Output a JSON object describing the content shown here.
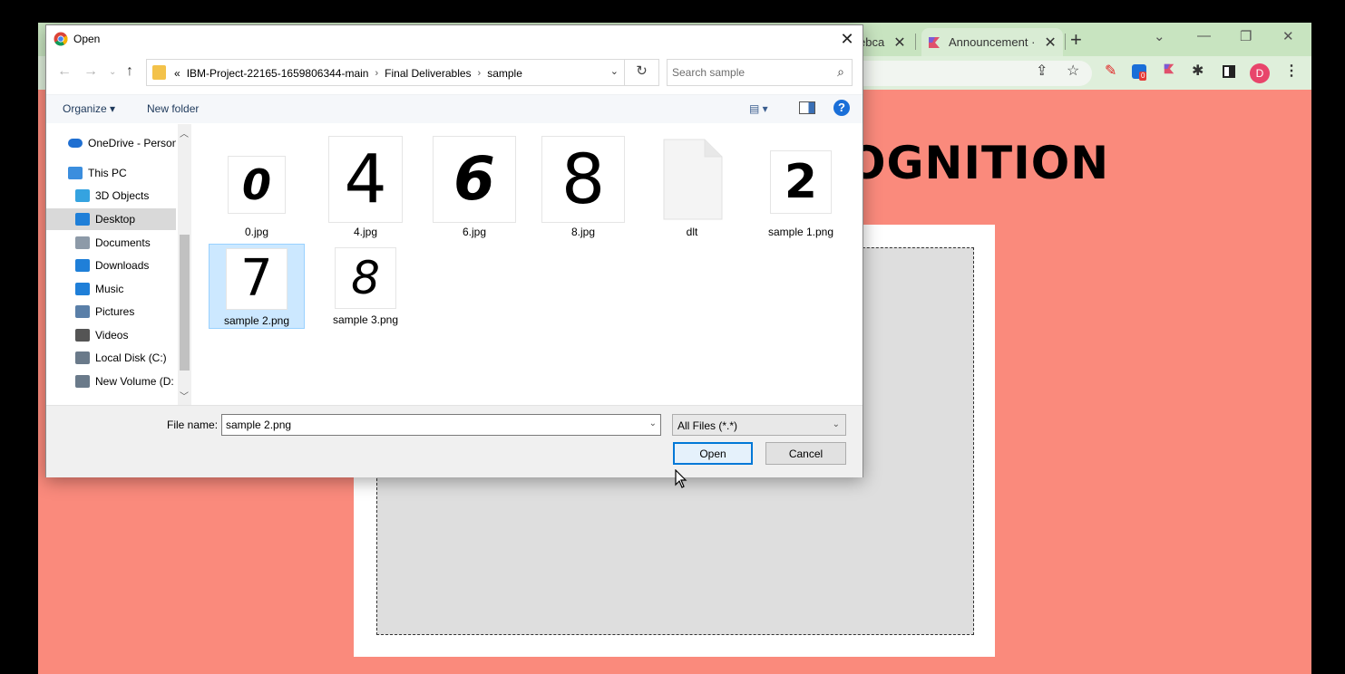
{
  "browser": {
    "tab1": {
      "label": "ebca"
    },
    "tab2": {
      "label": "Announcement ·"
    },
    "page_heading": "OGNITION",
    "profile_initial": "D",
    "extension_badge": "0"
  },
  "dialog": {
    "title": "Open",
    "address": {
      "prefix": "«",
      "crumbs": [
        "IBM-Project-22165-1659806344-main",
        "Final Deliverables",
        "sample"
      ]
    },
    "search": {
      "placeholder": "Search sample"
    },
    "commands": {
      "organize": "Organize ▾",
      "new_folder": "New folder"
    },
    "nav_items": [
      {
        "label": "OneDrive - Person",
        "icon": "cloud-icon",
        "color": "#1f6fd1"
      },
      {
        "label": "This PC",
        "icon": "computer-icon",
        "color": "#3b8ede"
      },
      {
        "label": "3D Objects",
        "icon": "cube-icon",
        "color": "#35a3e0"
      },
      {
        "label": "Desktop",
        "icon": "desktop-icon",
        "color": "#1f7fd8"
      },
      {
        "label": "Documents",
        "icon": "document-icon",
        "color": "#8d9aa8"
      },
      {
        "label": "Downloads",
        "icon": "download-icon",
        "color": "#1f7fd8"
      },
      {
        "label": "Music",
        "icon": "music-icon",
        "color": "#1f7fd8"
      },
      {
        "label": "Pictures",
        "icon": "pictures-icon",
        "color": "#5a7fa8"
      },
      {
        "label": "Videos",
        "icon": "film-icon",
        "color": "#555555"
      },
      {
        "label": "Local Disk (C:)",
        "icon": "drive-icon",
        "color": "#6a7a8a"
      },
      {
        "label": "New Volume (D:",
        "icon": "drive-icon",
        "color": "#6a7a8a"
      }
    ],
    "files": [
      {
        "name": "0.jpg",
        "digit": "0"
      },
      {
        "name": "4.jpg",
        "digit": "4"
      },
      {
        "name": "6.jpg",
        "digit": "6"
      },
      {
        "name": "8.jpg",
        "digit": "8"
      },
      {
        "name": "dlt",
        "digit": ""
      },
      {
        "name": "sample 1.png",
        "digit": "2"
      },
      {
        "name": "sample 2.png",
        "digit": "7"
      },
      {
        "name": "sample 3.png",
        "digit": "8"
      }
    ],
    "file_name": {
      "label": "File name:",
      "value": "sample 2.png"
    },
    "file_type": {
      "value": "All Files (*.*)"
    },
    "buttons": {
      "open": "Open",
      "cancel": "Cancel"
    }
  }
}
